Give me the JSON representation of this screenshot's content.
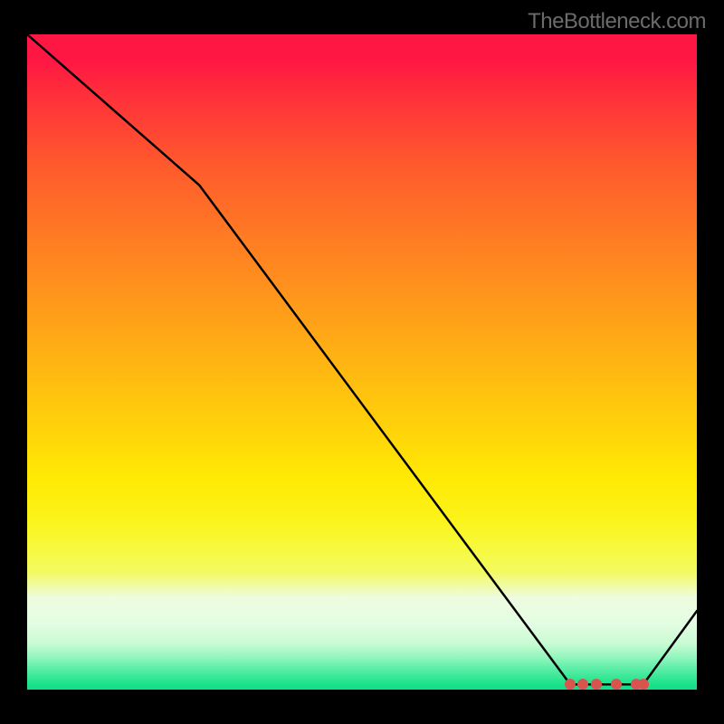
{
  "watermark": "TheBottleneck.com",
  "chart_data": {
    "type": "line",
    "title": "",
    "xlabel": "",
    "ylabel": "",
    "xlim": [
      0,
      100
    ],
    "ylim": [
      0,
      100
    ],
    "x": [
      0,
      25.7,
      81.1,
      83.0,
      85.0,
      88.0,
      91.0,
      92.0,
      100
    ],
    "y": [
      100,
      77.0,
      0.8,
      0.8,
      0.8,
      0.8,
      0.8,
      0.8,
      12.0
    ],
    "markers": [
      {
        "x": 81.1,
        "y": 0.8
      },
      {
        "x": 83.0,
        "y": 0.8
      },
      {
        "x": 85.0,
        "y": 0.8
      },
      {
        "x": 88.0,
        "y": 0.8
      },
      {
        "x": 91.0,
        "y": 0.8
      },
      {
        "x": 92.0,
        "y": 0.8
      }
    ],
    "colors": {
      "line": "#000000",
      "marker": "#d9534f",
      "gradient_top": "#ff1744",
      "gradient_mid": "#ffea04",
      "gradient_bottom": "#0ee085"
    }
  }
}
